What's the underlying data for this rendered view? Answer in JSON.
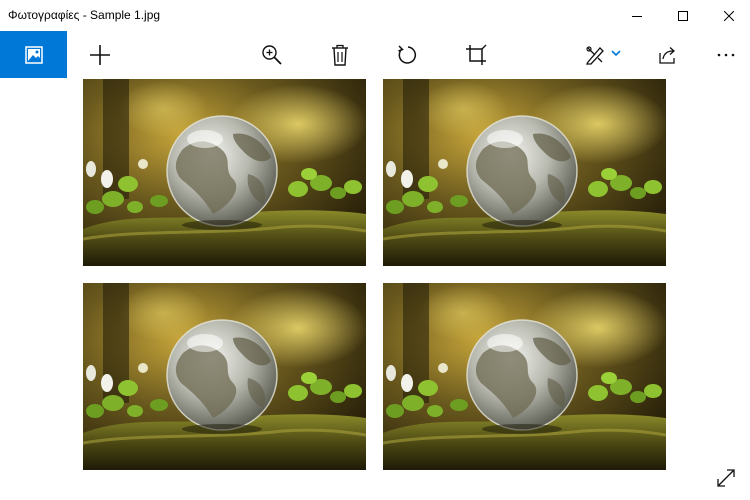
{
  "window": {
    "title": "Φωτογραφίες - Sample 1.jpg"
  },
  "title_bar_buttons": [
    "minimize-icon",
    "maximize-icon",
    "close-icon"
  ],
  "toolbar": {
    "buttons": [
      "collection-icon",
      "add-icon",
      "zoom-in-icon",
      "delete-icon",
      "rotate-icon",
      "crop-icon",
      "edit-draw-icon",
      "chevron-down-icon",
      "share-icon",
      "more-icon"
    ],
    "accent_color": "#0078d7"
  },
  "photos": {
    "count": 4,
    "subject": "glass-globe-on-moss"
  },
  "bottom": {
    "fullscreen_icon": "expand-icon"
  }
}
